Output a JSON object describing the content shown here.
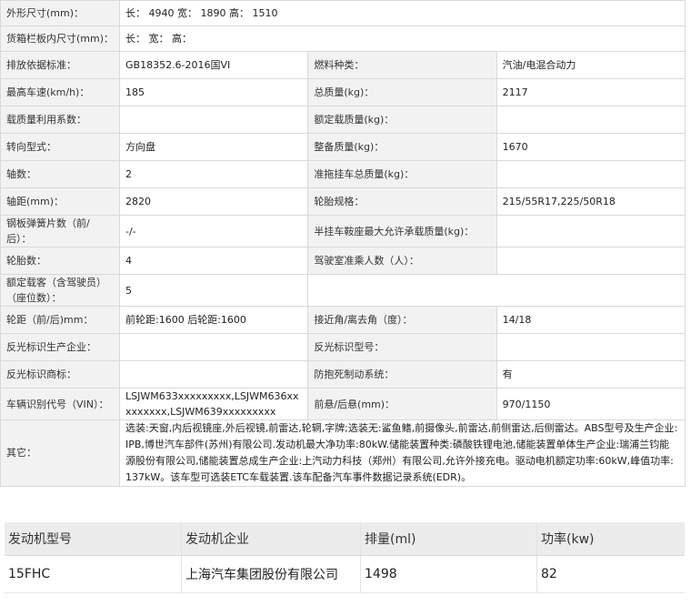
{
  "spec": {
    "outer_size_label": "外形尺寸(mm)：",
    "outer_size_value": "长： 4940  宽： 1890  高： 1510",
    "cargo_size_label": "货箱栏板内尺寸(mm)：",
    "cargo_size_value": "长：  宽：  高：",
    "emission_label": "排放依据标准：",
    "emission_value": "GB18352.6-2016国VI",
    "fuel_label": "燃料种类：",
    "fuel_value": "汽油/电混合动力",
    "max_speed_label": "最高车速(km/h)：",
    "max_speed_value": "185",
    "total_mass_label": "总质量(kg)：",
    "total_mass_value": "2117",
    "load_util_label": "载质量利用系数：",
    "load_util_value": "",
    "rated_load_label": "额定载质量(kg)：",
    "rated_load_value": "",
    "steering_label": "转向型式：",
    "steering_value": "方向盘",
    "curb_mass_label": "整备质量(kg)：",
    "curb_mass_value": "1670",
    "axles_label": "轴数：",
    "axles_value": "2",
    "trailer_mass_label": "准拖挂车总质量(kg)：",
    "trailer_mass_value": "",
    "wheelbase_label": "轴距(mm)：",
    "wheelbase_value": "2820",
    "tire_label": "轮胎规格：",
    "tire_value": "215/55R17,225/50R18",
    "leaf_spring_label": "钢板弹簧片数（前/后）：",
    "leaf_spring_value": "-/-",
    "saddle_label": "半挂车鞍座最大允许承载质量(kg)：",
    "saddle_value": "",
    "tire_count_label": "轮胎数：",
    "tire_count_value": "4",
    "cab_seats_label": "驾驶室准乘人数（人）：",
    "cab_seats_value": "",
    "rated_passengers_label": "额定载客（含驾驶员）（座位数）：",
    "rated_passengers_value": "5",
    "track_label": "轮距（前/后)mm：",
    "track_value": "前轮距:1600 后轮距:1600",
    "angle_label": "接近角/离去角（度）：",
    "angle_value": "14/18",
    "reflector_maker_label": "反光标识生产企业：",
    "reflector_maker_value": "",
    "reflector_model_label": "反光标识型号：",
    "reflector_model_value": "",
    "reflector_brand_label": "反光标识商标：",
    "reflector_brand_value": "",
    "abs_label": "防抱死制动系统：",
    "abs_value": "有",
    "vin_label": "车辆识别代号（VIN）：",
    "vin_value": "LSJWM633xxxxxxxxx,LSJWM636xxxxxxxxx,LSJWM639xxxxxxxxx",
    "overhang_label": "前悬/后悬(mm)：",
    "overhang_value": "970/1150",
    "other_label": "其它：",
    "other_value": "选装:天窗,内后视镜座,外后视镜,前雷达,轮辋,字牌;选装无:鲨鱼鳍,前摄像头,前雷达,前侧雷达,后侧雷达。ABS型号及生产企业:IPB,博世汽车部件(苏州)有限公司.发动机最大净功率:80kW.储能装置种类:磷酸铁锂电池,储能装置单体生产企业:瑞浦兰钧能源股份有限公司,储能装置总成生产企业:上汽动力科技（郑州）有限公司,允许外接充电。驱动电机额定功率:60kW,峰值功率:137kW。该车型可选装ETC车载装置.该车配备汽车事件数据记录系统(EDR)。"
  },
  "engine": {
    "headers": [
      "发动机型号",
      "发动机企业",
      "排量(ml)",
      "功率(kw)"
    ],
    "row": [
      "15FHC",
      "上海汽车集团股份有限公司",
      "1498",
      "82"
    ]
  }
}
